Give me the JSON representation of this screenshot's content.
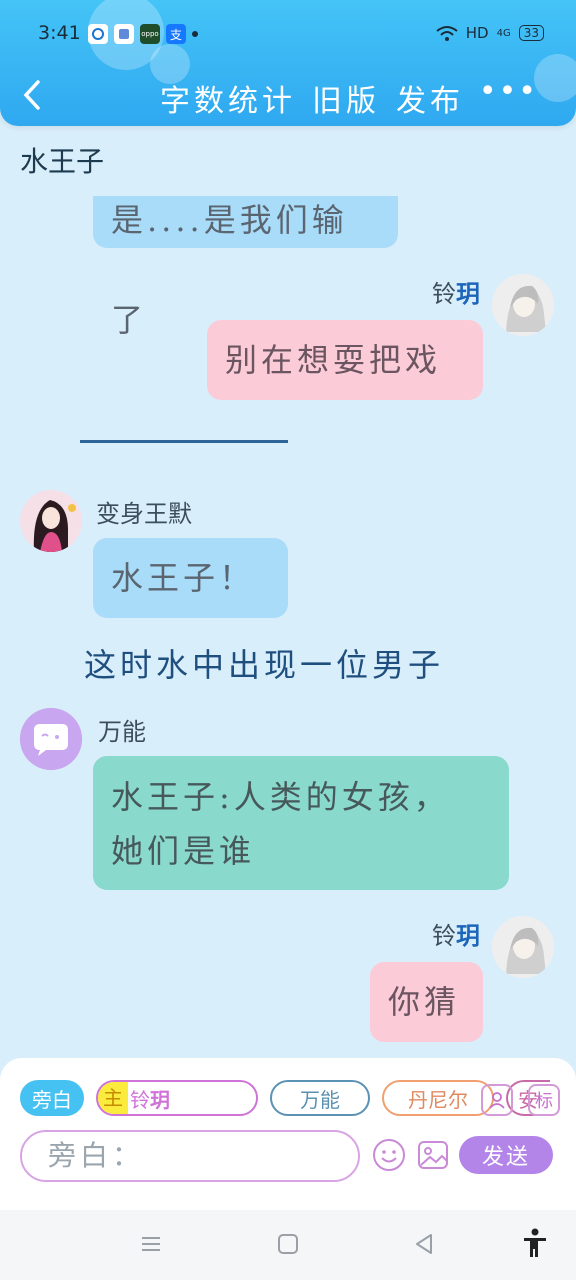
{
  "status_bar": {
    "time": "3:41",
    "notif_icons": [
      "circle-app-icon",
      "square-app-icon",
      "oppo-icon",
      "alipay-icon"
    ],
    "oppo_label": "oppo",
    "alipay_label": "支",
    "hd_label": "HD",
    "signal_label": "4G",
    "battery": "33"
  },
  "header": {
    "title_items": [
      "字数统计",
      "旧版",
      "发布"
    ],
    "more_label": "•••"
  },
  "chat_title": "水王子",
  "messages": [
    {
      "type": "bubble",
      "color": "blue",
      "text": "是....是我们输了"
    },
    {
      "type": "speaker",
      "name": "铃",
      "name_bold": "玥"
    },
    {
      "type": "bubble",
      "color": "pink",
      "text": "别在想耍把戏"
    },
    {
      "type": "speaker",
      "name": "变身王默"
    },
    {
      "type": "bubble",
      "color": "blue",
      "text": "水王子！"
    },
    {
      "type": "narration",
      "text": "这时水中出现一位男子"
    },
    {
      "type": "speaker",
      "name": "万能"
    },
    {
      "type": "bubble",
      "color": "green",
      "lines": [
        "水王子:人类的女孩，",
        "她们是谁"
      ]
    },
    {
      "type": "speaker",
      "name": "铃",
      "name_bold": "玥"
    },
    {
      "type": "bubble",
      "color": "pink",
      "text": "你猜"
    }
  ],
  "input_panel": {
    "roles": {
      "narration": "旁白",
      "main_tag": "主",
      "main_name": "铃",
      "main_name_bold": "玥",
      "wanneng": "万能",
      "danier": "丹尼尔",
      "an": "安"
    },
    "person_icon": "person-icon",
    "mark_label": "标",
    "placeholder": "旁白：",
    "send_label": "发送"
  },
  "colors": {
    "header": "#2fa8f0",
    "bubble_blue": "#a8dcf9",
    "bubble_pink": "#fbccd8",
    "bubble_green": "#8ad9cd",
    "send": "#b385e8"
  }
}
